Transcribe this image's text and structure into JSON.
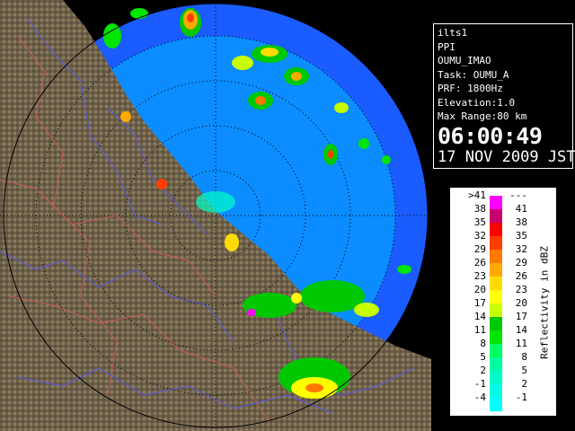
{
  "info": {
    "lines": [
      "ilts1",
      "PPI",
      "OUMU_IMAO",
      "Task: OUMU_A",
      "PRF: 1800Hz",
      "Elevation:1.0",
      "Max Range:80 km"
    ],
    "time": "06:00:49",
    "date": "17 NOV 2009 JST"
  },
  "legend": {
    "title": "Reflectivity in dBZ",
    "rows": [
      {
        "left": ">41",
        "right": "---",
        "color": "#ff00ff"
      },
      {
        "left": "38",
        "right": "41",
        "color": "#c8006e"
      },
      {
        "left": "35",
        "right": "38",
        "color": "#ff0000"
      },
      {
        "left": "32",
        "right": "35",
        "color": "#ff3c00"
      },
      {
        "left": "29",
        "right": "32",
        "color": "#ff7800"
      },
      {
        "left": "26",
        "right": "29",
        "color": "#ffaa00"
      },
      {
        "left": "23",
        "right": "26",
        "color": "#ffdc00"
      },
      {
        "left": "20",
        "right": "23",
        "color": "#ffff00"
      },
      {
        "left": "17",
        "right": "20",
        "color": "#c8ff00"
      },
      {
        "left": "14",
        "right": "17",
        "color": "#00c800"
      },
      {
        "left": "11",
        "right": "14",
        "color": "#00e600"
      },
      {
        "left": "8",
        "right": "11",
        "color": "#00ff64"
      },
      {
        "left": "5",
        "right": "8",
        "color": "#00ffa0"
      },
      {
        "left": "2",
        "right": "5",
        "color": "#00ffc8"
      },
      {
        "left": "-1",
        "right": "2",
        "color": "#00ffe6"
      },
      {
        "left": "-4",
        "right": "-1",
        "color": "#00ffff"
      }
    ]
  },
  "colors": {
    "sea_outer": "#1a5cff",
    "sea_inner": "#0b8cff",
    "land": "#6b5f48",
    "range_ring": "#000000"
  }
}
